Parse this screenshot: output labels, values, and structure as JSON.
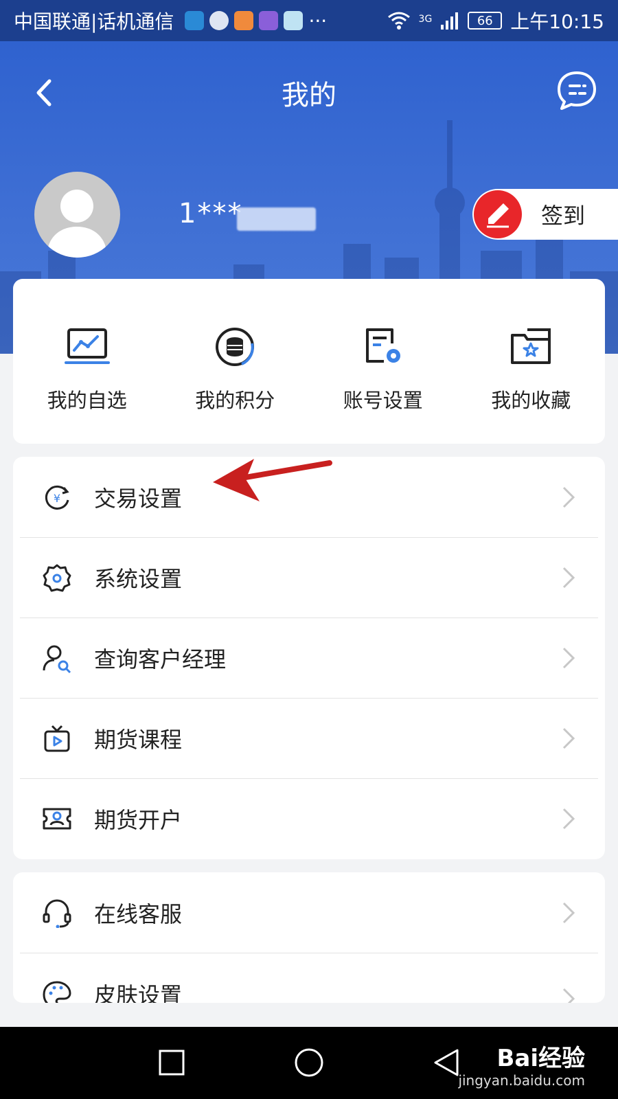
{
  "status_bar": {
    "carrier": "中国联通|话机通信",
    "more": "···",
    "network": "3G",
    "battery": "66",
    "time": "上午10:15"
  },
  "header": {
    "title": "我的"
  },
  "profile": {
    "username": "1***",
    "checkin_label": "签到"
  },
  "shortcuts": [
    {
      "label": "我的自选",
      "icon": "chart-monitor-icon"
    },
    {
      "label": "我的积分",
      "icon": "coins-icon"
    },
    {
      "label": "账号设置",
      "icon": "account-settings-icon"
    },
    {
      "label": "我的收藏",
      "icon": "favorites-folder-icon"
    }
  ],
  "menu_group_1": [
    {
      "label": "交易设置",
      "icon": "yuan-cycle-icon"
    },
    {
      "label": "系统设置",
      "icon": "gear-icon"
    },
    {
      "label": "查询客户经理",
      "icon": "user-search-icon"
    },
    {
      "label": "期货课程",
      "icon": "tv-play-icon"
    },
    {
      "label": "期货开户",
      "icon": "id-card-icon"
    }
  ],
  "menu_group_2": [
    {
      "label": "在线客服",
      "icon": "headset-icon"
    },
    {
      "label": "皮肤设置",
      "icon": "palette-icon"
    }
  ],
  "watermark": {
    "brand": "Bai经验",
    "url": "jingyan.baidu.com"
  },
  "colors": {
    "header_blue": "#2f62cf",
    "accent_red": "#e8262a",
    "icon_blue": "#3b82e6"
  }
}
